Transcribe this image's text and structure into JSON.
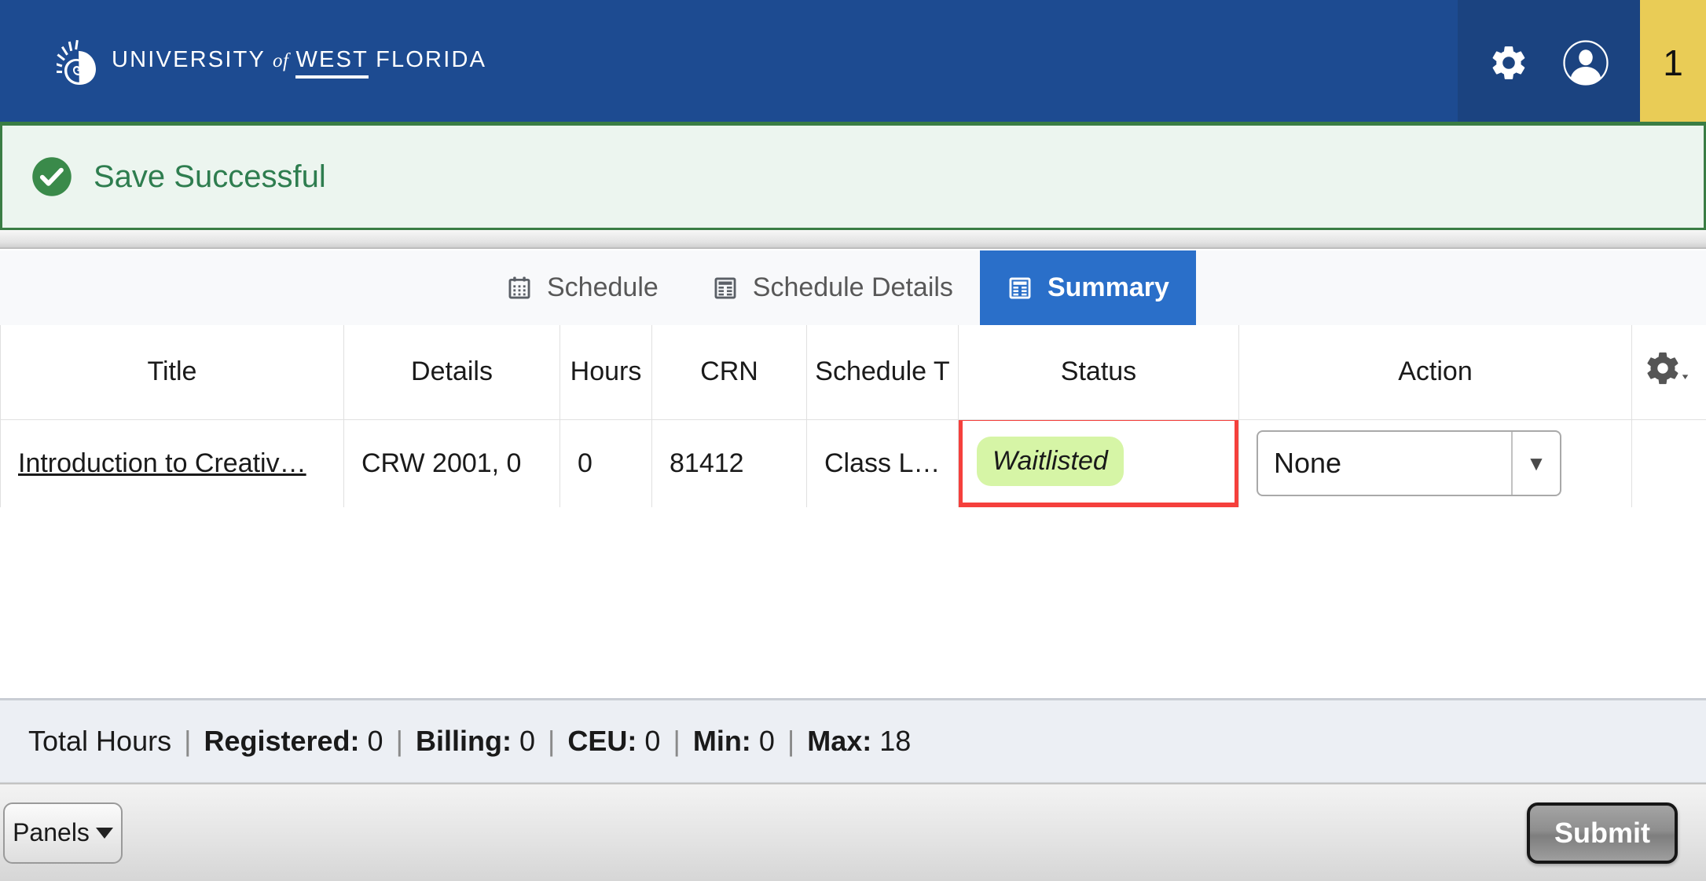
{
  "header": {
    "brand_university": "UNIVERSITY",
    "brand_of": "of",
    "brand_west": "WEST",
    "brand_florida": "FLORIDA",
    "gear_icon": "gear-icon",
    "avatar_icon": "user-avatar-icon",
    "badge_count": "1",
    "bg_color": "#1d4b91",
    "badge_color": "#e9cc56"
  },
  "banner": {
    "message": "Save Successful",
    "icon": "check-circle-icon",
    "text_color": "#2e7d4f",
    "bg_color": "#ecf5ef",
    "border_color": "#3a7d44"
  },
  "tabs": [
    {
      "label": "Schedule",
      "icon": "calendar-icon",
      "active": false
    },
    {
      "label": "Schedule Details",
      "icon": "table-grid-icon",
      "active": false
    },
    {
      "label": "Summary",
      "icon": "table-grid-icon",
      "active": true
    }
  ],
  "table": {
    "headers": {
      "title": "Title",
      "details": "Details",
      "hours": "Hours",
      "crn": "CRN",
      "schedule_type": "Schedule T",
      "status": "Status",
      "action": "Action",
      "settings_icon": "gear-icon"
    },
    "rows": [
      {
        "title": "Introduction to Creativ…",
        "details": "CRW 2001, 0",
        "hours": "0",
        "crn": "81412",
        "schedule_type": "Class L…",
        "status": "Waitlisted",
        "action": "None",
        "status_highlight_color": "#f5403c",
        "status_badge_color": "#d6f5a6"
      }
    ]
  },
  "totals": {
    "label": "Total Hours",
    "registered_label": "Registered:",
    "registered_value": "0",
    "billing_label": "Billing:",
    "billing_value": "0",
    "ceu_label": "CEU:",
    "ceu_value": "0",
    "min_label": "Min:",
    "min_value": "0",
    "max_label": "Max:",
    "max_value": "18",
    "separator": "|"
  },
  "bottom_bar": {
    "panels_label": "Panels",
    "submit_label": "Submit"
  }
}
